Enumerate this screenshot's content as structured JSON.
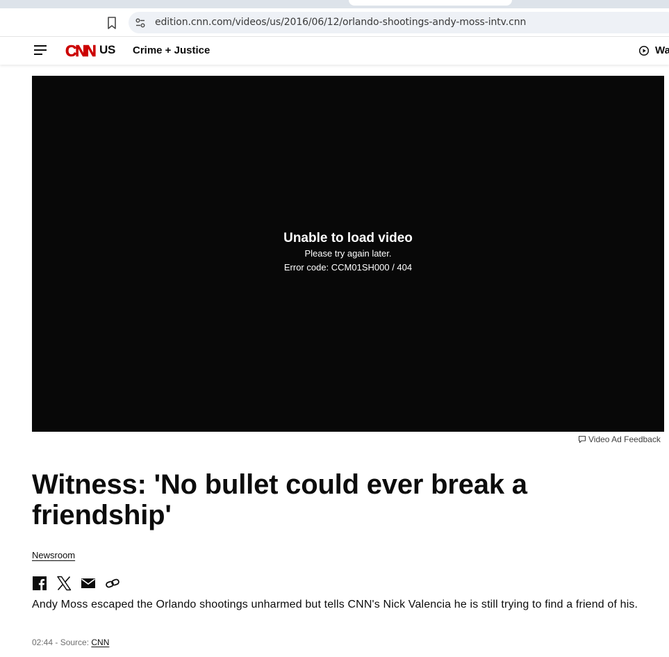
{
  "browser": {
    "url": "edition.cnn.com/videos/us/2016/06/12/orlando-shootings-andy-moss-intv.cnn"
  },
  "header": {
    "logo": "CNN",
    "edition": "US",
    "section": "Crime + Justice",
    "watch_label": "Watch"
  },
  "video": {
    "error_title": "Unable to load video",
    "error_message": "Please try again later.",
    "error_code": "Error code: CCM01SH000 / 404",
    "ad_feedback": "Video Ad Feedback"
  },
  "article": {
    "headline": "Witness: 'No bullet could ever break a friendship'",
    "byline": "Newsroom",
    "description": "Andy Moss escaped the Orlando shootings unharmed but tells CNN's Nick Valencia he is still trying to find a friend of his.",
    "duration": "02:44",
    "source_prefix": " - Source: ",
    "source": "CNN"
  },
  "share_icons": [
    "facebook-icon",
    "x-icon",
    "email-icon",
    "link-icon"
  ],
  "colors": {
    "cnn_red": "#cc0000",
    "video_bg": "#080808",
    "text": "#0c0c0c",
    "meta_gray": "#6e6e6e"
  }
}
